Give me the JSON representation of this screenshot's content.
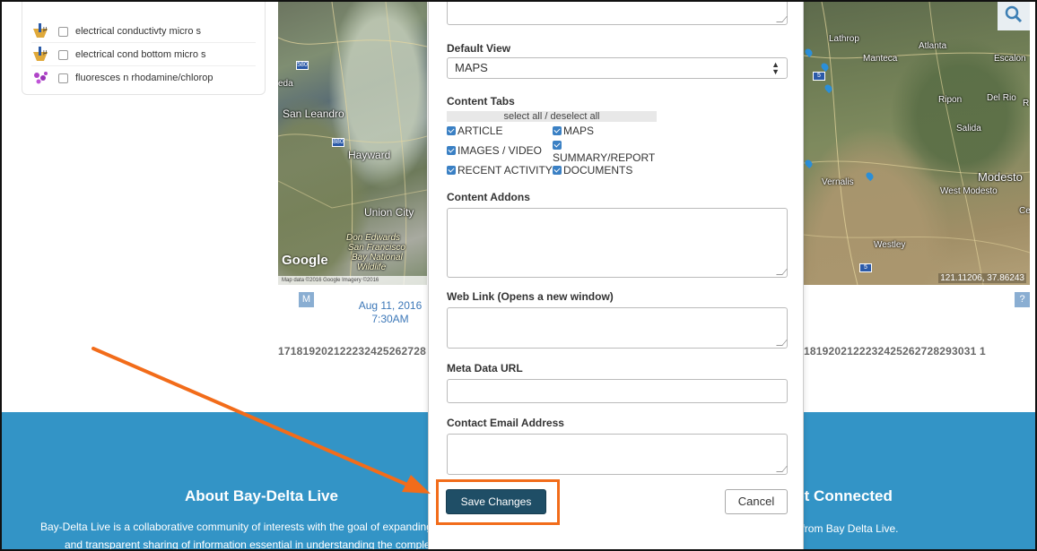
{
  "layers": {
    "items": [
      {
        "label": "electrical conductivty micro s",
        "icon": "bucket-meter-icon"
      },
      {
        "label": "electrical cond bottom micro s",
        "icon": "bucket-meter-icon"
      },
      {
        "label": "fluoresces n rhodamine/chlorop",
        "icon": "algae-icon"
      }
    ]
  },
  "map_left": {
    "labels": {
      "san_leandro": "San Leandro",
      "hayward": "Hayward",
      "union_city": "Union City",
      "don_edwards": "Don Edwards",
      "san_francisco": "San Francisco",
      "bay_national": "Bay National",
      "wildlife": "Wildlife",
      "eda": "eda"
    },
    "shields": {
      "i580": "580",
      "i880": "880"
    },
    "google": "Google",
    "attribution": "Map data ©2016 Google Imagery ©2016"
  },
  "map_right": {
    "labels": {
      "lathrop": "Lathrop",
      "atlanta": "Atlanta",
      "manteca": "Manteca",
      "escalon": "Escalon",
      "ripon": "Ripon",
      "del_rio": "Del Rio",
      "salida": "Salida",
      "modesto": "Modesto",
      "west_modesto": "West Modesto",
      "vernalis": "Vernalis",
      "westley": "Westley",
      "ce": "Ce",
      "r": "R"
    },
    "shields": {
      "i5_top": "5",
      "i5_bottom": "5"
    },
    "coords": "121.11206, 37.86243"
  },
  "timeline": {
    "m_badge": "M",
    "q_badge": "?",
    "date_line1": "Aug 11, 2016",
    "date_line2": "7:30AM",
    "days_left": "171819202122232425262728",
    "days_right": "1819202122232425262728293031 1"
  },
  "footer": {
    "about_title": "About Bay-Delta Live",
    "about_line1": "Bay-Delta Live is a collaborative community of interests with the goal of expanding open",
    "about_line2": "and transparent sharing of information essential in understanding the complex and",
    "connect_title": "Get Connected",
    "connect_text": "Sign up to receive email updates from Bay Delta Live."
  },
  "modal": {
    "default_view_label": "Default View",
    "default_view_value": "MAPS",
    "content_tabs_label": "Content Tabs",
    "select_all": "select all / deselect all",
    "tabs": {
      "article": "ARTICLE",
      "maps": "MAPS",
      "images_video": "IMAGES / VIDEO",
      "summary_report": "SUMMARY/REPORT",
      "recent_activity": "RECENT ACTIVITY",
      "documents": "DOCUMENTS"
    },
    "content_addons_label": "Content Addons",
    "web_link_label": "Web Link (Opens a new window)",
    "meta_data_label": "Meta Data URL",
    "contact_email_label": "Contact Email Address",
    "save_label": "Save Changes",
    "cancel_label": "Cancel"
  },
  "colors": {
    "footer_bg": "#3394c6",
    "save_bg": "#1f4e66",
    "highlight": "#f26c1a",
    "checkbox": "#3a80c4"
  }
}
